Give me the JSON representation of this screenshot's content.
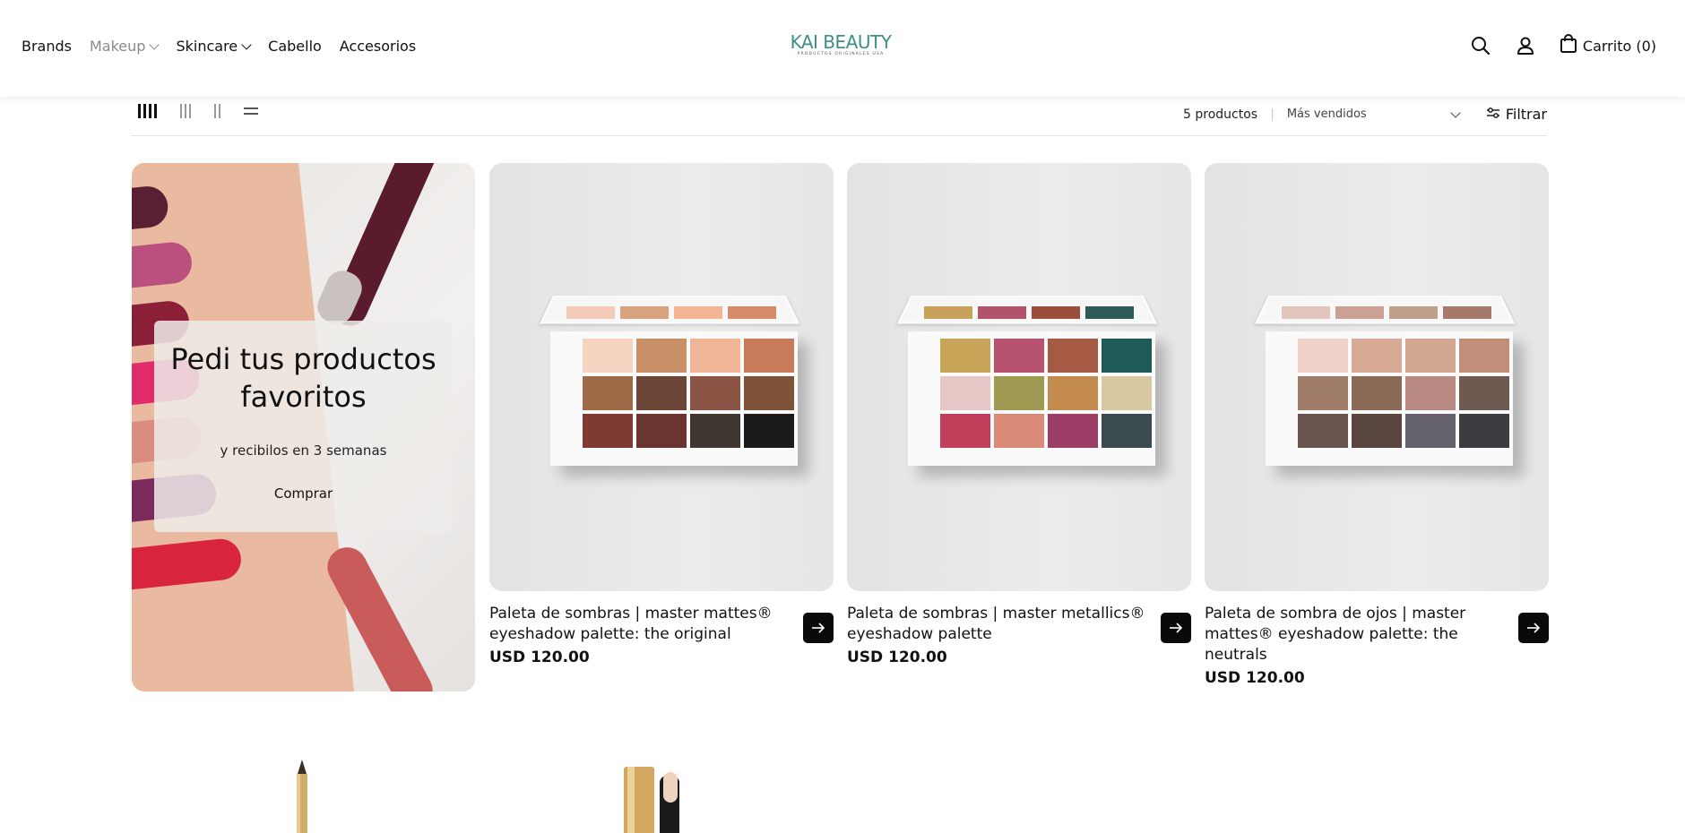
{
  "brand": {
    "name": "KAI BEAUTY",
    "tagline": "PRODUCTOS ORIGINALES USA",
    "color": "#3e8f86"
  },
  "nav": {
    "items": [
      {
        "label": "Brands",
        "dropdown": false,
        "active": false
      },
      {
        "label": "Makeup",
        "dropdown": true,
        "active": true
      },
      {
        "label": "Skincare",
        "dropdown": true,
        "active": false
      },
      {
        "label": "Cabello",
        "dropdown": false,
        "active": false
      },
      {
        "label": "Accesorios",
        "dropdown": false,
        "active": false
      }
    ]
  },
  "header": {
    "cart_label": "Carrito (0)",
    "icons": [
      "search-icon",
      "account-icon",
      "shopping-bag-icon"
    ]
  },
  "toolbar": {
    "view_options": [
      "grid-4",
      "grid-3",
      "grid-2",
      "list"
    ],
    "active_view": "grid-4",
    "product_count": "5 productos",
    "sort_selected": "Más vendidos",
    "filter_label": "Filtrar"
  },
  "promo": {
    "title": "Pedi tus productos favoritos",
    "subtitle": "y recibilos en 3 semanas",
    "cta": "Comprar"
  },
  "products": [
    {
      "name": "Paleta de sombras | master mattes® eyeshadow palette: the original",
      "price": "USD 120.00",
      "lid_colors": [
        "#f4cbb8",
        "#d9a27e",
        "#f2b695",
        "#d58c6a"
      ],
      "pan_colors": [
        "#f7d3c2",
        "#c98f66",
        "#f0b597",
        "#c77b58",
        "#9e6a47",
        "#6b4536",
        "#8c5444",
        "#7e5238",
        "#7d3b33",
        "#6a3530",
        "#3f3531",
        "#1b1b1b"
      ]
    },
    {
      "name": "Paleta de sombras | master metallics® eyeshadow palette",
      "price": "USD 120.00",
      "lid_colors": [
        "#c8a25a",
        "#b2536b",
        "#9a4f3c",
        "#2d5b58"
      ],
      "pan_colors": [
        "#c9a55a",
        "#b8536f",
        "#a65a43",
        "#1e5a57",
        "#e7c6c6",
        "#9f9a52",
        "#c48b4f",
        "#d9c9a3",
        "#c23f5b",
        "#d98b78",
        "#9c3e66",
        "#3b4a4e"
      ]
    },
    {
      "name": "Paleta de sombra de ojos | master mattes® eyeshadow palette: the neutrals",
      "price": "USD 120.00",
      "lid_colors": [
        "#e2c6bd",
        "#c9a195",
        "#bfa08c",
        "#a57a6c"
      ],
      "pan_colors": [
        "#efd1c8",
        "#d9ab96",
        "#d2a791",
        "#c08e79",
        "#9f7b69",
        "#8b6a58",
        "#b98a82",
        "#6f5a52",
        "#6b5450",
        "#5a4640",
        "#66626e",
        "#3c3b42"
      ]
    }
  ]
}
